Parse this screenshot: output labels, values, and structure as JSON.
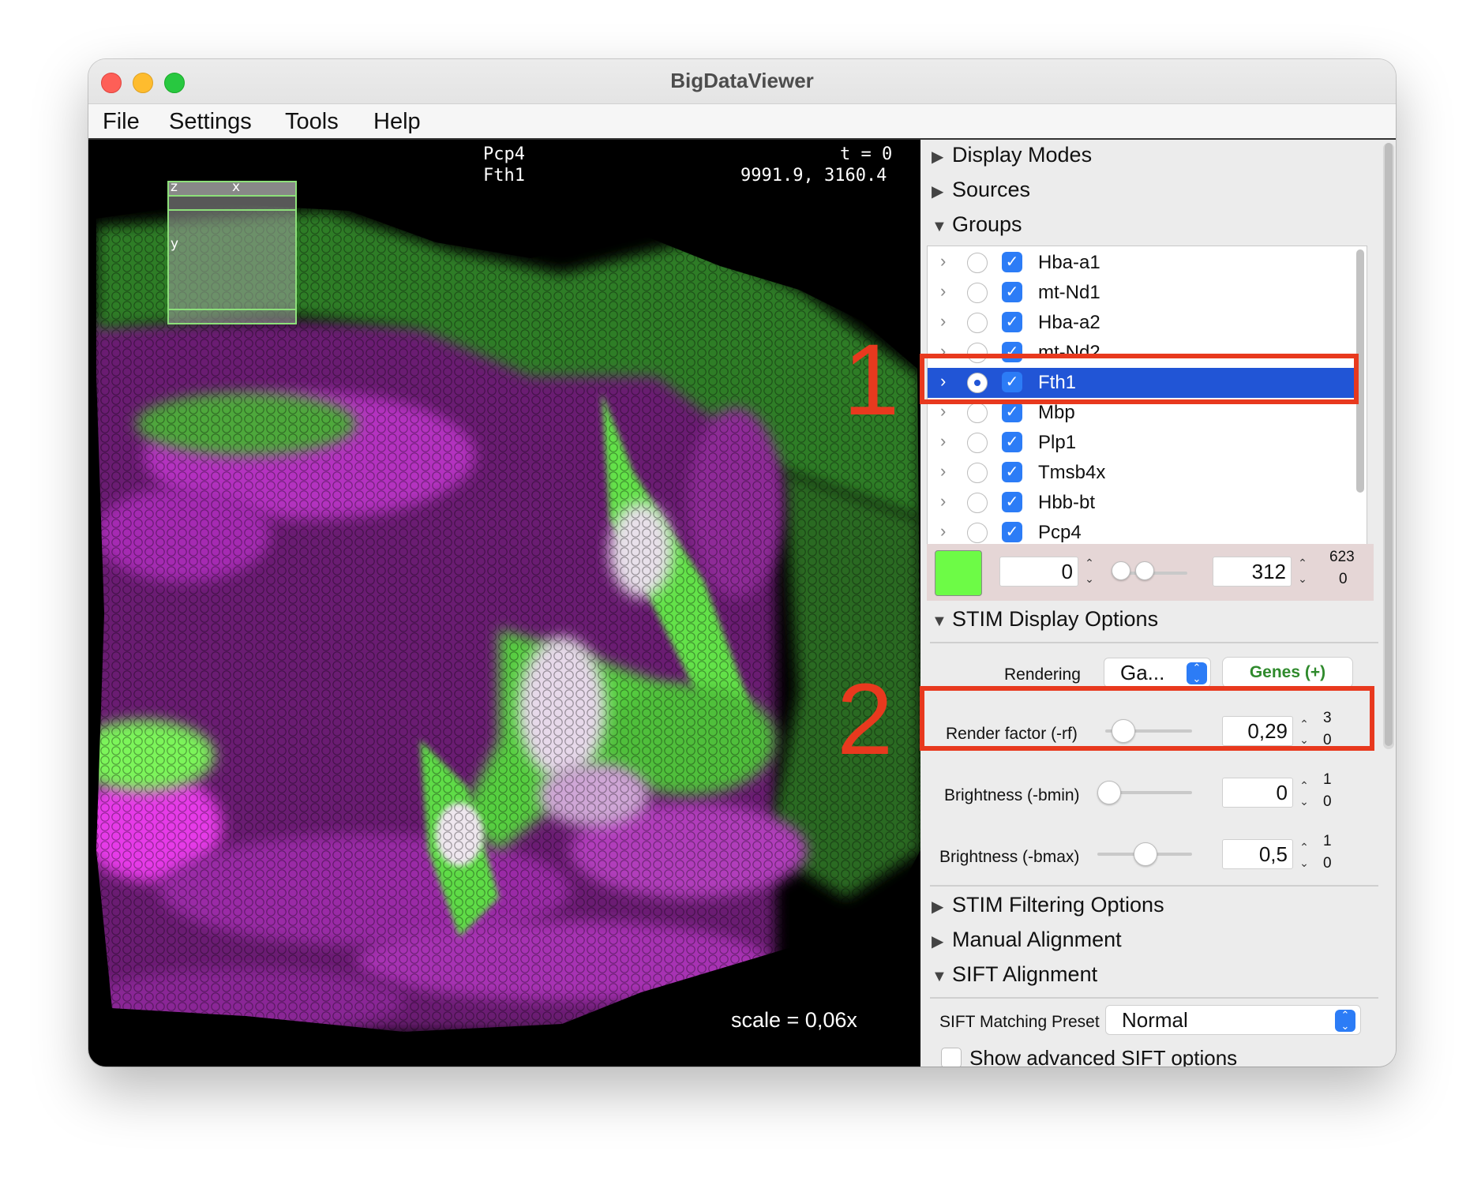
{
  "window": {
    "title": "BigDataViewer"
  },
  "menu": {
    "items": [
      "File",
      "Settings",
      "Tools",
      "Help"
    ]
  },
  "viewer": {
    "source_line1": "Pcp4",
    "source_line2": "Fth1",
    "time_label": "t = 0",
    "coordinates": "9991.9, 3160.4",
    "scale_label": "scale = 0,06x",
    "navigator": {
      "z": "z",
      "x": "x",
      "y": "y"
    },
    "colors": {
      "channel_a": "#6dfb46",
      "channel_b": "#e02ee6"
    }
  },
  "panel": {
    "sections": {
      "display_modes": "Display Modes",
      "sources": "Sources",
      "groups": "Groups",
      "stim_display": "STIM Display Options",
      "stim_filtering": "STIM Filtering Options",
      "manual_alignment": "Manual Alignment",
      "sift_alignment": "SIFT Alignment"
    },
    "groups": [
      {
        "name": "Hba-a1",
        "selected": false
      },
      {
        "name": "mt-Nd1",
        "selected": false
      },
      {
        "name": "Hba-a2",
        "selected": false
      },
      {
        "name": "mt-Nd2",
        "selected": false
      },
      {
        "name": "Fth1",
        "selected": true
      },
      {
        "name": "Mbp",
        "selected": false
      },
      {
        "name": "Plp1",
        "selected": false
      },
      {
        "name": "Tmsb4x",
        "selected": false
      },
      {
        "name": "Hbb-bt",
        "selected": false
      },
      {
        "name": "Pcp4",
        "selected": false
      }
    ],
    "brightness_range": {
      "color": "#6dfb46",
      "min": "0",
      "max": "312",
      "range_max": "623",
      "range_min": "0"
    },
    "stim": {
      "rendering_label": "Rendering",
      "rendering_value": "Ga...",
      "genes_button": "Genes (+)",
      "render_factor": {
        "label": "Render factor (-rf)",
        "value": "0,29",
        "max": "3",
        "min": "0",
        "fraction": 0.097
      },
      "bmin": {
        "label": "Brightness (-bmin)",
        "value": "0",
        "max": "1",
        "min": "0",
        "fraction": 0.0
      },
      "bmax": {
        "label": "Brightness (-bmax)",
        "value": "0,5",
        "max": "1",
        "min": "0",
        "fraction": 0.5
      }
    },
    "sift": {
      "preset_label": "SIFT Matching Preset",
      "preset_value": "Normal",
      "advanced_label": "Show advanced SIFT options"
    }
  },
  "annotations": {
    "callout1": "1",
    "callout2": "2",
    "highlight_color": "#e8391e"
  }
}
